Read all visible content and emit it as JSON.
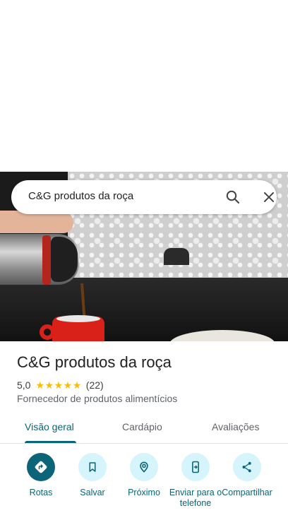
{
  "search": {
    "query": "C&G produtos da roça",
    "search_icon": "search-icon",
    "close_icon": "close-icon"
  },
  "place": {
    "name": "C&G produtos da roça",
    "rating": "5,0",
    "stars": 5,
    "reviews_count": "(22)",
    "category": "Fornecedor de produtos alimentícios"
  },
  "tabs": [
    {
      "label": "Visão geral",
      "active": true
    },
    {
      "label": "Cardápio",
      "active": false
    },
    {
      "label": "Avaliações",
      "active": false
    }
  ],
  "actions": [
    {
      "label": "Rotas",
      "icon": "directions-icon",
      "primary": true
    },
    {
      "label": "Salvar",
      "icon": "bookmark-icon",
      "primary": false
    },
    {
      "label": "Próximo",
      "icon": "nearby-icon",
      "primary": false
    },
    {
      "label": "Enviar para o telefone",
      "icon": "send-to-phone-icon",
      "primary": false
    },
    {
      "label": "Compartilhar",
      "icon": "share-icon",
      "primary": false
    }
  ],
  "colors": {
    "accent": "#0b6477",
    "accent_light": "#d6f4fb",
    "star": "#fbbc04"
  }
}
